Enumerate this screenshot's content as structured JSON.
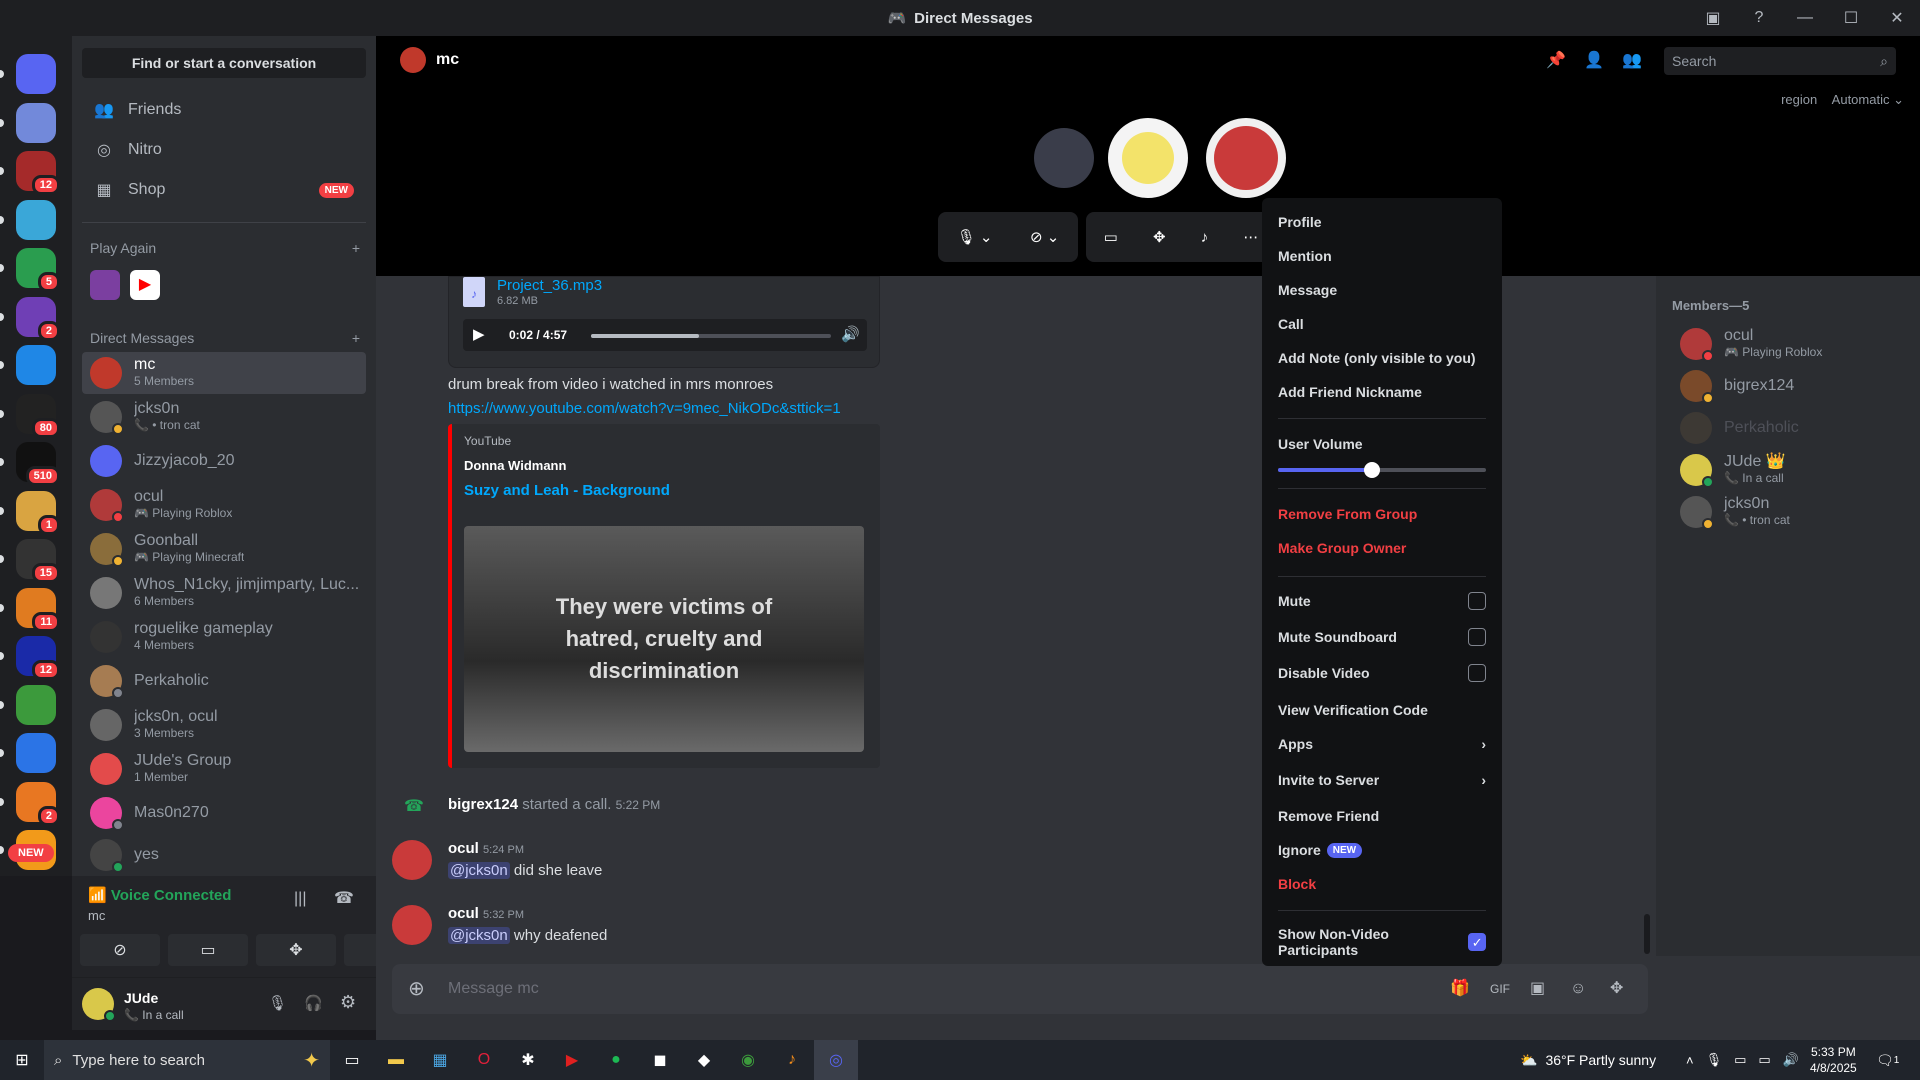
{
  "window": {
    "title": "Direct Messages"
  },
  "servers": [
    {
      "color": "#5865f2",
      "badge": ""
    },
    {
      "color": "#7289da",
      "badge": ""
    },
    {
      "color": "#a52a2a",
      "badge": "12"
    },
    {
      "color": "#3aa7d8",
      "badge": ""
    },
    {
      "color": "#2a9d4f",
      "badge": "5"
    },
    {
      "color": "#6f3fb5",
      "badge": "2"
    },
    {
      "color": "#1f87e6",
      "badge": ""
    },
    {
      "color": "#222222",
      "badge": "80"
    },
    {
      "color": "#111111",
      "badge": "510"
    },
    {
      "color": "#d9a441",
      "badge": "1"
    },
    {
      "color": "#333333",
      "badge": "15"
    },
    {
      "color": "#e07b20",
      "badge": "11"
    },
    {
      "color": "#1a2aa8",
      "badge": "12"
    },
    {
      "color": "#3c9a3c",
      "badge": ""
    },
    {
      "color": "#2b74e6",
      "badge": ""
    },
    {
      "color": "#e87722",
      "badge": "2"
    },
    {
      "color": "#f29a1a",
      "badge": ""
    }
  ],
  "server_new": "NEW",
  "dmcol": {
    "find": "Find or start a conversation",
    "nav": [
      {
        "label": "Friends",
        "icon": "👥"
      },
      {
        "label": "Nitro",
        "icon": "◎"
      },
      {
        "label": "Shop",
        "icon": "▦",
        "badge": "NEW"
      }
    ],
    "play_again": "Play Again",
    "direct_messages": "Direct Messages",
    "plus": "+",
    "items": [
      {
        "name": "mc",
        "sub": "5 Members",
        "color": "#c0392b",
        "status": ""
      },
      {
        "name": "jcks0n",
        "sub": "📞 • tron cat",
        "color": "#555",
        "status": "#f0b232"
      },
      {
        "name": "Jizzyjacob_20",
        "sub": "",
        "color": "#5865f2",
        "status": ""
      },
      {
        "name": "ocul",
        "sub": "🎮 Playing Roblox",
        "color": "#b03a3a",
        "status": "#f23f43"
      },
      {
        "name": "Goonball",
        "sub": "🎮 Playing Minecraft",
        "color": "#8a6d3b",
        "status": "#f0b232"
      },
      {
        "name": "Whos_N1cky, jimjimparty, Luc...",
        "sub": "6 Members",
        "color": "#777",
        "status": ""
      },
      {
        "name": "roguelike gameplay",
        "sub": "4 Members",
        "color": "#333",
        "status": ""
      },
      {
        "name": "Perkaholic",
        "sub": "",
        "color": "#a67c52",
        "status": "#80848e"
      },
      {
        "name": "jcks0n, ocul",
        "sub": "3 Members",
        "color": "#666",
        "status": ""
      },
      {
        "name": "JUde's Group",
        "sub": "1 Member",
        "color": "#e34b4b",
        "status": ""
      },
      {
        "name": "Mas0n270",
        "sub": "",
        "color": "#eb459e",
        "status": "#80848e"
      },
      {
        "name": "yes",
        "sub": "",
        "color": "#444",
        "status": "#23a55a"
      }
    ]
  },
  "voice": {
    "title": "Voice Connected",
    "sub": "mc"
  },
  "user": {
    "name": "JUde",
    "status": "📞 In a call"
  },
  "channel": {
    "name": "mc",
    "search": "Search",
    "region_label": "region",
    "region_value": "Automatic"
  },
  "attachment": {
    "name": "Project_36.mp3",
    "size": "6.82 MB",
    "time": "0:02 / 4:57",
    "progress": 0.45
  },
  "messages": {
    "m1": "drum break from video i watched in mrs monroes",
    "link": "https://www.youtube.com/watch?v=9mec_NikODc&sttick=1",
    "embed_provider": "YouTube",
    "embed_author": "Donna Widmann",
    "embed_title": "Suzy and Leah - Background",
    "embed_image_text": "They were victims of hatred, cruelty and discrimination",
    "call_user": "bigrex124",
    "call_text": "started a call.",
    "call_time": "5:22 PM",
    "a1": "ocul",
    "t1": "5:24 PM",
    "mention1": "@jcks0n",
    "b1": "did she leave",
    "a2": "ocul",
    "t2": "5:32 PM",
    "mention2": "@jcks0n",
    "b2": "why deafened"
  },
  "input_placeholder": "Message mc",
  "members": {
    "header": "Members—5",
    "list": [
      {
        "name": "ocul",
        "sub": "🎮 Playing Roblox",
        "color": "#b03a3a",
        "status": "#f23f43"
      },
      {
        "name": "bigrex124",
        "sub": "",
        "color": "#7a4a2a",
        "status": "#f0b232"
      },
      {
        "name": "Perkaholic",
        "sub": "",
        "color": "#5a4a3a",
        "status": ""
      },
      {
        "name": "JUde 👑",
        "sub": "📞 In a call",
        "color": "#d9c84a",
        "status": "#23a55a"
      },
      {
        "name": "jcks0n",
        "sub": "📞 • tron cat",
        "color": "#555",
        "status": "#f0b232"
      }
    ]
  },
  "context_menu": {
    "profile": "Profile",
    "mention": "Mention",
    "message": "Message",
    "call": "Call",
    "add_note": "Add Note (only visible to you)",
    "add_nick": "Add Friend Nickname",
    "user_volume": "User Volume",
    "volume": 0.45,
    "remove_group": "Remove From Group",
    "make_owner": "Make Group Owner",
    "mute": "Mute",
    "mute_sb": "Mute Soundboard",
    "disable_video": "Disable Video",
    "verify": "View Verification Code",
    "apps": "Apps",
    "invite": "Invite to Server",
    "remove_friend": "Remove Friend",
    "ignore": "Ignore",
    "ignore_badge": "NEW",
    "block": "Block",
    "show_nonvideo": "Show Non-Video Participants"
  },
  "taskbar": {
    "search": "Type here to search",
    "weather": "36°F  Partly sunny",
    "time": "5:33 PM",
    "date": "4/8/2025",
    "notif": "1"
  }
}
